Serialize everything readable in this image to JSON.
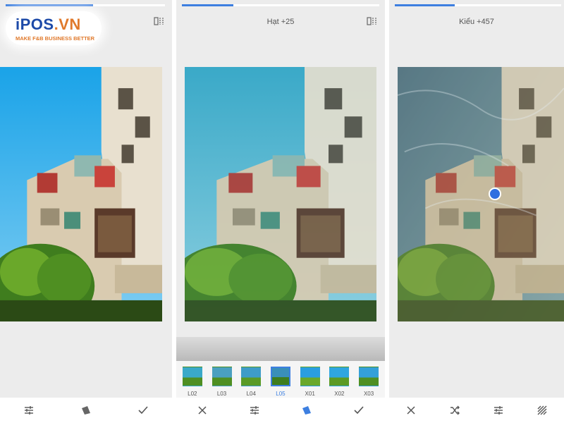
{
  "watermark": {
    "brand": "iPOS",
    "brand_suffix": ".VN",
    "tagline": "MAKE F&B BUSINESS BETTER"
  },
  "screens": [
    {
      "progress": 0.55,
      "toolbar": [
        "tune-icon",
        "filter-style-icon",
        "checkmark-icon"
      ]
    },
    {
      "progress": 0.26,
      "top_label": "Hạt +25",
      "filters": [
        {
          "label": "L02",
          "selected": false
        },
        {
          "label": "L03",
          "selected": false
        },
        {
          "label": "L04",
          "selected": false
        },
        {
          "label": "L05",
          "selected": true
        },
        {
          "label": "X01",
          "selected": false
        },
        {
          "label": "X02",
          "selected": false
        },
        {
          "label": "X03",
          "selected": false
        }
      ],
      "toolbar": [
        "close-icon",
        "tune-icon",
        "filter-style-icon",
        "checkmark-icon"
      ]
    },
    {
      "progress": 0.36,
      "top_label": "Kiểu +457",
      "toolbar": [
        "close-icon",
        "shuffle-icon",
        "tune-icon",
        "texture-icon"
      ]
    }
  ],
  "colors": {
    "accent": "#3d7fe0",
    "brand_blue": "#1d4aa8",
    "brand_orange": "#e0792b"
  }
}
